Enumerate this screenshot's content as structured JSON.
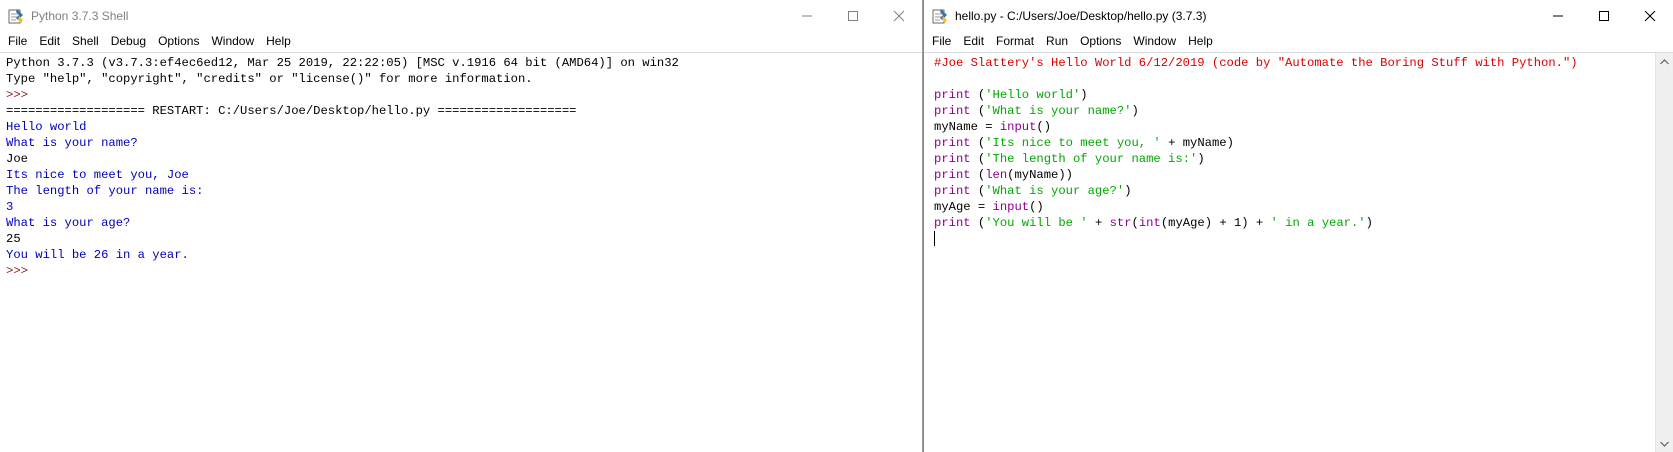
{
  "shell": {
    "title": "Python 3.7.3 Shell",
    "menu": [
      "File",
      "Edit",
      "Shell",
      "Debug",
      "Options",
      "Window",
      "Help"
    ],
    "lines": [
      {
        "parts": [
          {
            "text": "Python 3.7.3 (v3.7.3:ef4ec6ed12, Mar 25 2019, 22:22:05) [MSC v.1916 64 bit (AMD64)] on win32",
            "color": "black"
          }
        ]
      },
      {
        "parts": [
          {
            "text": "Type \"help\", \"copyright\", \"credits\" or \"license()\" for more information.",
            "color": "black"
          }
        ]
      },
      {
        "parts": [
          {
            "text": ">>> ",
            "color": "prompt"
          }
        ]
      },
      {
        "parts": [
          {
            "text": "=================== RESTART: C:/Users/Joe/Desktop/hello.py ===================",
            "color": "black"
          }
        ]
      },
      {
        "parts": [
          {
            "text": "Hello world",
            "color": "blue"
          }
        ]
      },
      {
        "parts": [
          {
            "text": "What is your name?",
            "color": "blue"
          }
        ]
      },
      {
        "parts": [
          {
            "text": "Joe",
            "color": "black"
          }
        ]
      },
      {
        "parts": [
          {
            "text": "Its nice to meet you, Joe",
            "color": "blue"
          }
        ]
      },
      {
        "parts": [
          {
            "text": "The length of your name is:",
            "color": "blue"
          }
        ]
      },
      {
        "parts": [
          {
            "text": "3",
            "color": "blue"
          }
        ]
      },
      {
        "parts": [
          {
            "text": "What is your age?",
            "color": "blue"
          }
        ]
      },
      {
        "parts": [
          {
            "text": "25",
            "color": "black"
          }
        ]
      },
      {
        "parts": [
          {
            "text": "You will be 26 in a year.",
            "color": "blue"
          }
        ]
      },
      {
        "parts": [
          {
            "text": ">>> ",
            "color": "prompt"
          }
        ]
      }
    ]
  },
  "editor": {
    "title": "hello.py - C:/Users/Joe/Desktop/hello.py (3.7.3)",
    "menu": [
      "File",
      "Edit",
      "Format",
      "Run",
      "Options",
      "Window",
      "Help"
    ],
    "lines": [
      {
        "parts": [
          {
            "text": "#Joe Slattery's Hello World 6/12/2019 (code by \"Automate the Boring Stuff with Python.\")",
            "color": "red"
          }
        ]
      },
      {
        "parts": []
      },
      {
        "parts": [
          {
            "text": "print",
            "color": "purple"
          },
          {
            "text": " (",
            "color": "black"
          },
          {
            "text": "'Hello world'",
            "color": "green"
          },
          {
            "text": ")",
            "color": "black"
          }
        ]
      },
      {
        "parts": [
          {
            "text": "print",
            "color": "purple"
          },
          {
            "text": " (",
            "color": "black"
          },
          {
            "text": "'What is your name?'",
            "color": "green"
          },
          {
            "text": ")",
            "color": "black"
          }
        ]
      },
      {
        "parts": [
          {
            "text": "myName = ",
            "color": "black"
          },
          {
            "text": "input",
            "color": "purple"
          },
          {
            "text": "()",
            "color": "black"
          }
        ]
      },
      {
        "parts": [
          {
            "text": "print",
            "color": "purple"
          },
          {
            "text": " (",
            "color": "black"
          },
          {
            "text": "'Its nice to meet you, '",
            "color": "green"
          },
          {
            "text": " + myName)",
            "color": "black"
          }
        ]
      },
      {
        "parts": [
          {
            "text": "print",
            "color": "purple"
          },
          {
            "text": " (",
            "color": "black"
          },
          {
            "text": "'The length of your name is:'",
            "color": "green"
          },
          {
            "text": ")",
            "color": "black"
          }
        ]
      },
      {
        "parts": [
          {
            "text": "print",
            "color": "purple"
          },
          {
            "text": " (",
            "color": "black"
          },
          {
            "text": "len",
            "color": "purple"
          },
          {
            "text": "(myName))",
            "color": "black"
          }
        ]
      },
      {
        "parts": [
          {
            "text": "print",
            "color": "purple"
          },
          {
            "text": " (",
            "color": "black"
          },
          {
            "text": "'What is your age?'",
            "color": "green"
          },
          {
            "text": ")",
            "color": "black"
          }
        ]
      },
      {
        "parts": [
          {
            "text": "myAge = ",
            "color": "black"
          },
          {
            "text": "input",
            "color": "purple"
          },
          {
            "text": "()",
            "color": "black"
          }
        ]
      },
      {
        "parts": [
          {
            "text": "print",
            "color": "purple"
          },
          {
            "text": " (",
            "color": "black"
          },
          {
            "text": "'You will be '",
            "color": "green"
          },
          {
            "text": " + ",
            "color": "black"
          },
          {
            "text": "str",
            "color": "purple"
          },
          {
            "text": "(",
            "color": "black"
          },
          {
            "text": "int",
            "color": "purple"
          },
          {
            "text": "(myAge) + 1) + ",
            "color": "black"
          },
          {
            "text": "' in a year.'",
            "color": "green"
          },
          {
            "text": ")",
            "color": "black"
          }
        ]
      },
      {
        "parts": [],
        "caret": true
      }
    ]
  },
  "icons": {
    "app": "idle-python-icon",
    "minimize": "minimize-icon",
    "maximize": "maximize-icon",
    "close": "close-icon",
    "scroll_up": "chevron-up-icon",
    "scroll_down": "chevron-down-icon"
  },
  "colors": {
    "black": "#000000",
    "blue": "#0000c0",
    "purple": "#900090",
    "green": "#00aa00",
    "red": "#dd0000",
    "prompt": "#902020"
  }
}
